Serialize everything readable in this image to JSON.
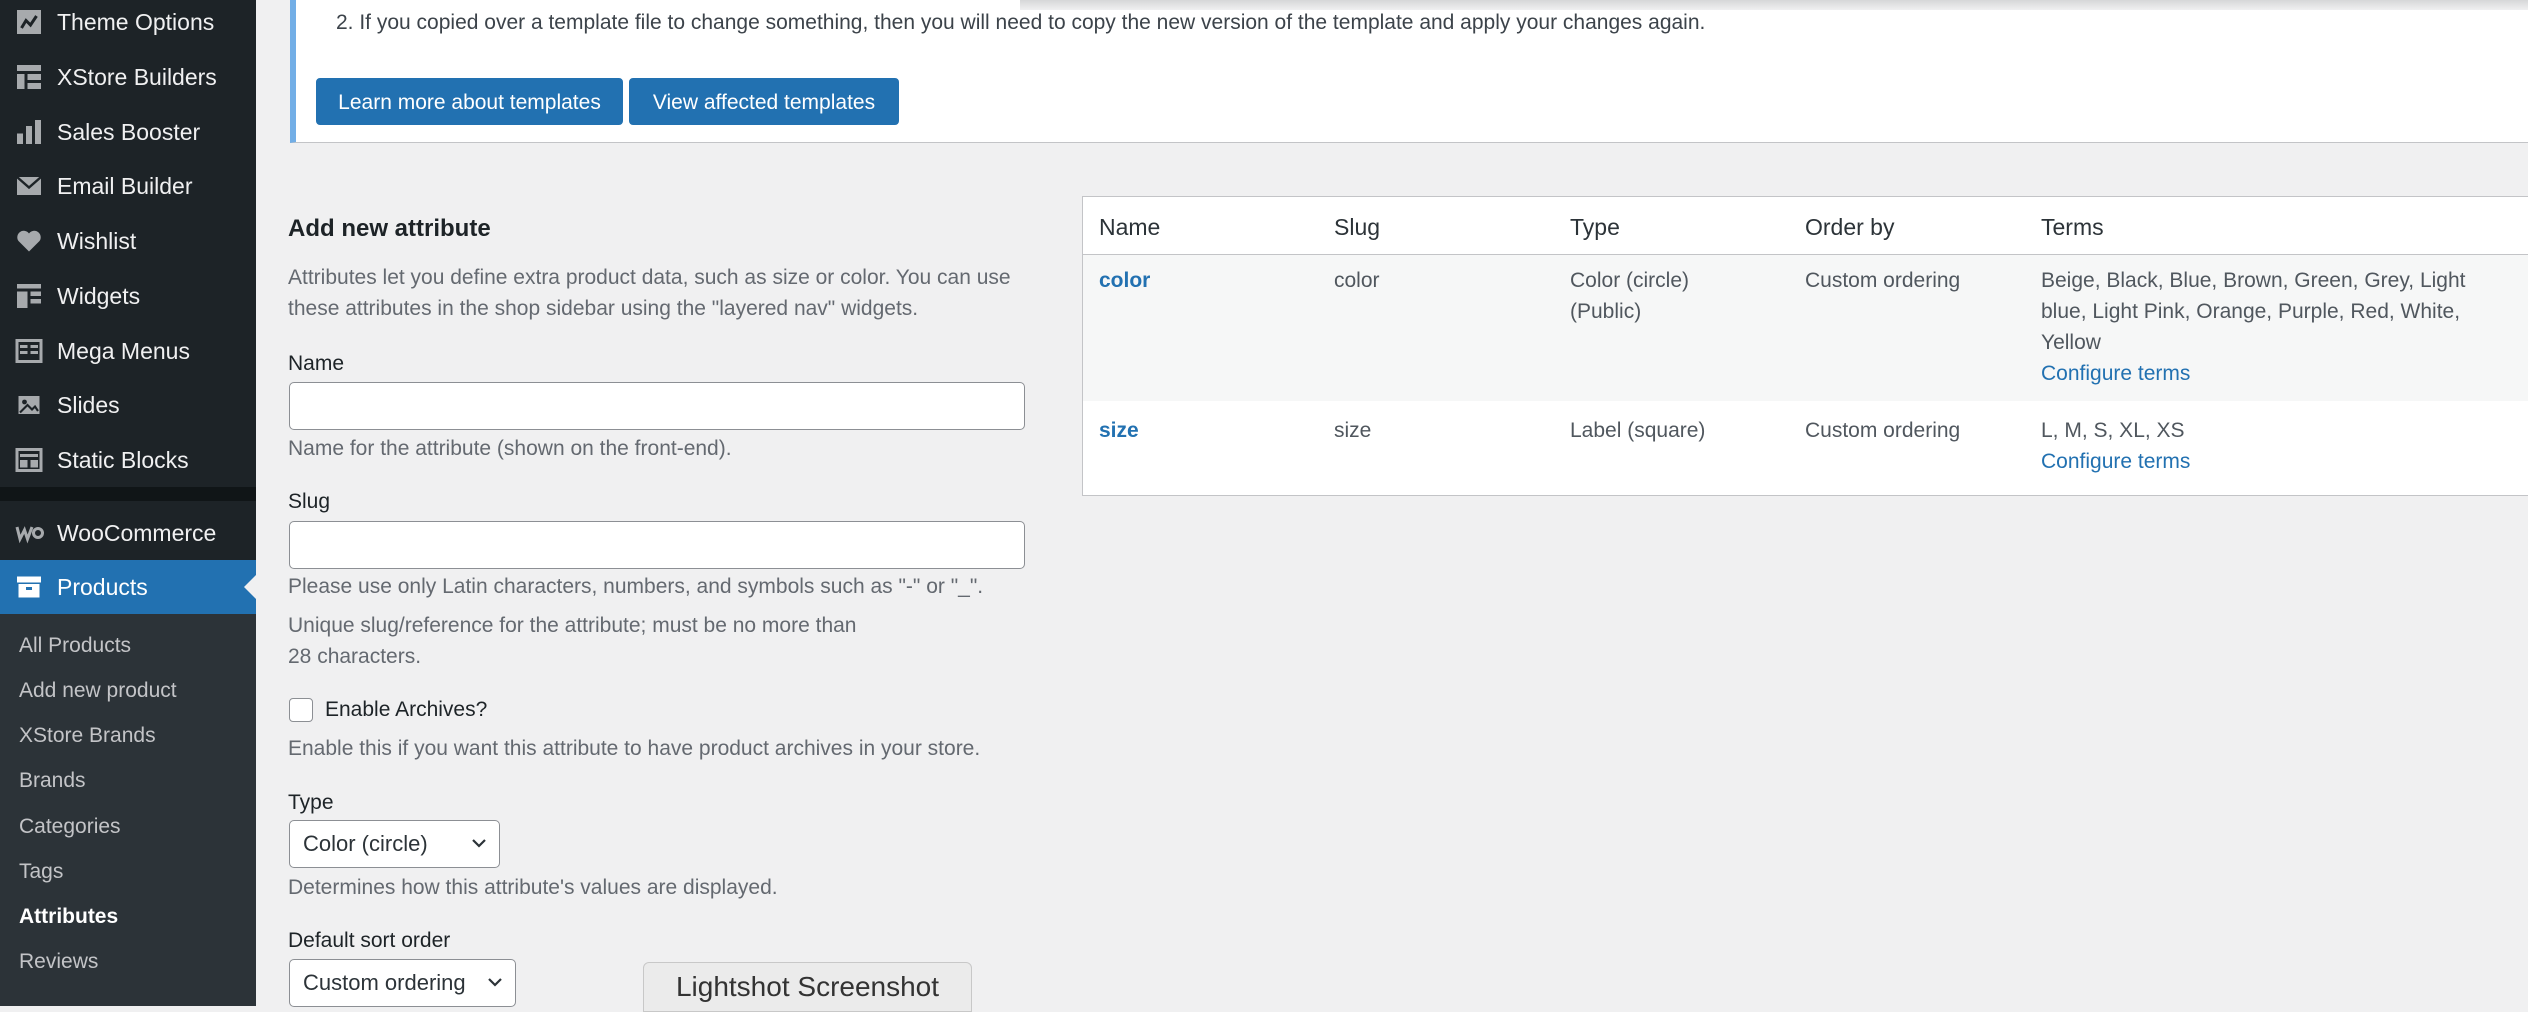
{
  "sidebar": {
    "menu": [
      {
        "label": "Theme Options",
        "icon": "theme-options-icon"
      },
      {
        "label": "XStore Builders",
        "icon": "grid-icon"
      },
      {
        "label": "Sales Booster",
        "icon": "bar-chart-icon"
      },
      {
        "label": "Email Builder",
        "icon": "envelope-icon"
      },
      {
        "label": "Wishlist",
        "icon": "heart-icon"
      },
      {
        "label": "Widgets",
        "icon": "widgets-icon"
      },
      {
        "label": "Mega Menus",
        "icon": "mega-menu-icon"
      },
      {
        "label": "Slides",
        "icon": "slides-icon"
      },
      {
        "label": "Static Blocks",
        "icon": "static-blocks-icon"
      },
      {
        "label": "WooCommerce",
        "icon": "woocommerce-icon"
      },
      {
        "label": "Products",
        "icon": "archive-box-icon"
      }
    ],
    "submenu": [
      {
        "label": "All Products"
      },
      {
        "label": "Add new product"
      },
      {
        "label": "XStore Brands"
      },
      {
        "label": "Brands"
      },
      {
        "label": "Categories"
      },
      {
        "label": "Tags"
      },
      {
        "label": "Attributes"
      },
      {
        "label": "Reviews"
      }
    ],
    "current_submenu": "Attributes"
  },
  "notice": {
    "line": "2. If you copied over a template file to change something, then you will need to copy the new version of the template and apply your changes again.",
    "learn_button": "Learn more about templates",
    "view_button": "View affected templates"
  },
  "form": {
    "title": "Add new attribute",
    "intro_1": "Attributes let you define extra product data, such as size or color. You can use",
    "intro_2": "these attributes in the shop sidebar using the \"layered nav\" widgets.",
    "name_label": "Name",
    "name_value": "",
    "name_desc": "Name for the attribute (shown on the front-end).",
    "slug_label": "Slug",
    "slug_value": "",
    "slug_desc_1": "Please use only Latin characters, numbers, and symbols such as \"-\" or \"_\".",
    "slug_desc_2": "Unique slug/reference for the attribute; must be no more than",
    "slug_desc_3": "28 characters.",
    "archives_label": "Enable Archives?",
    "archives_checked": false,
    "archives_desc": "Enable this if you want this attribute to have product archives in your store.",
    "type_label": "Type",
    "type_value": "Color (circle)",
    "type_desc": "Determines how this attribute's values are displayed.",
    "sort_label": "Default sort order",
    "sort_value": "Custom ordering"
  },
  "table": {
    "headers": {
      "name": "Name",
      "slug": "Slug",
      "type": "Type",
      "order": "Order by",
      "terms": "Terms"
    },
    "rows": [
      {
        "name": "color",
        "slug": "color",
        "type_1": "Color (circle)",
        "type_2": "(Public)",
        "order": "Custom ordering",
        "terms_1": "Beige, Black, Blue, Brown, Green, Grey, Light",
        "terms_2": "blue, Light Pink, Orange, Purple, Red, White,",
        "terms_3": "Yellow",
        "configure": "Configure terms"
      },
      {
        "name": "size",
        "slug": "size",
        "type_1": "Label (square)",
        "order": "Custom ordering",
        "terms_1": "L, M, S, XL, XS",
        "configure": "Configure terms"
      }
    ]
  },
  "overlay": {
    "lightshot": "Lightshot Screenshot"
  },
  "colors": {
    "sidebar_bg": "#1d2327",
    "accent": "#2271b1",
    "notice_border": "#72aee6"
  }
}
